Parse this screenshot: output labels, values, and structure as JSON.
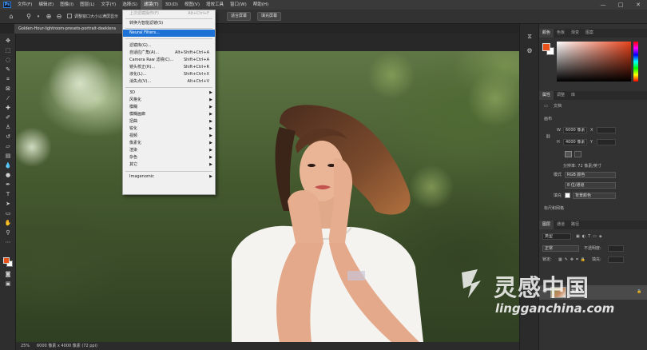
{
  "app": {
    "logo": "Ps"
  },
  "menubar": {
    "items": [
      "文件(F)",
      "编辑(E)",
      "图像(I)",
      "图层(L)",
      "文字(Y)",
      "选择(S)",
      "滤镜(T)",
      "3D(D)",
      "视图(V)",
      "增效工具",
      "窗口(W)",
      "帮助(H)"
    ],
    "active_index": 6,
    "window_controls": [
      "—",
      "□",
      "✕"
    ]
  },
  "options": {
    "resize_windows_label": "调整窗口大小以满屏显示",
    "fit_screen_label": "适合屏幕",
    "fill_screen_label": "填充屏幕"
  },
  "document": {
    "tab_title": "Golden-Hour-lightroom-presets-portrait-deeklens",
    "zoom": "25%",
    "info": "6000 像素 x 4000 像素 (72 ppi)"
  },
  "filter_menu": {
    "items": [
      {
        "label": "上次滤镜操作(F)",
        "shortcut": "Alt+Ctrl+F",
        "disabled": true
      },
      {
        "separator": true
      },
      {
        "label": "转换为智能滤镜(S)",
        "shortcut": ""
      },
      {
        "separator": true
      },
      {
        "label": "Neural Filters...",
        "shortcut": "",
        "highlighted": true
      },
      {
        "separator": true
      },
      {
        "label": "滤镜库(G)...",
        "shortcut": ""
      },
      {
        "label": "自适应广角(A)...",
        "shortcut": "Alt+Shift+Ctrl+A"
      },
      {
        "label": "Camera Raw 滤镜(C)...",
        "shortcut": "Shift+Ctrl+A"
      },
      {
        "label": "镜头校正(R)...",
        "shortcut": "Shift+Ctrl+R"
      },
      {
        "label": "液化(L)...",
        "shortcut": "Shift+Ctrl+X"
      },
      {
        "label": "消失点(V)...",
        "shortcut": "Alt+Ctrl+V"
      },
      {
        "separator": true
      },
      {
        "label": "3D",
        "submenu": true
      },
      {
        "label": "风格化",
        "submenu": true
      },
      {
        "label": "模糊",
        "submenu": true
      },
      {
        "label": "模糊画廊",
        "submenu": true
      },
      {
        "label": "扭曲",
        "submenu": true
      },
      {
        "label": "锐化",
        "submenu": true
      },
      {
        "label": "视频",
        "submenu": true
      },
      {
        "label": "像素化",
        "submenu": true
      },
      {
        "label": "渲染",
        "submenu": true
      },
      {
        "label": "杂色",
        "submenu": true
      },
      {
        "label": "其它",
        "submenu": true
      },
      {
        "separator": true
      },
      {
        "label": "Imagenomic",
        "submenu": true
      }
    ]
  },
  "color_panel": {
    "tabs": [
      "颜色",
      "色板",
      "渐变",
      "图案"
    ],
    "foreground": "#e8521a",
    "background": "#ffffff",
    "accent": "#1e72d6"
  },
  "properties_panel": {
    "tabs": [
      "属性",
      "调整",
      "库"
    ],
    "doc_label": "文档",
    "canvas_label": "画布",
    "w_label": "W",
    "w_value": "6000 像素",
    "x_label": "X",
    "h_label": "H",
    "h_value": "4000 像素",
    "y_label": "Y",
    "resolution": "分辨率: 72 像素/英寸",
    "mode_label": "模式",
    "mode_value": "RGB 颜色",
    "depth_value": "8 位/通道",
    "fill_label": "填充",
    "bg_color_label": "背景颜色",
    "rulers_label": "标尺和网格"
  },
  "layers_panel": {
    "tabs": [
      "图层",
      "通道",
      "路径"
    ],
    "search_placeholder": "类型",
    "blend_mode": "正常",
    "opacity_label": "不透明度:",
    "lock_label": "锁定:",
    "fill_label": "填充:",
    "layer_name": "背景"
  },
  "watermark": {
    "cn": "灵感中国",
    "en": "lingganchina.com"
  }
}
